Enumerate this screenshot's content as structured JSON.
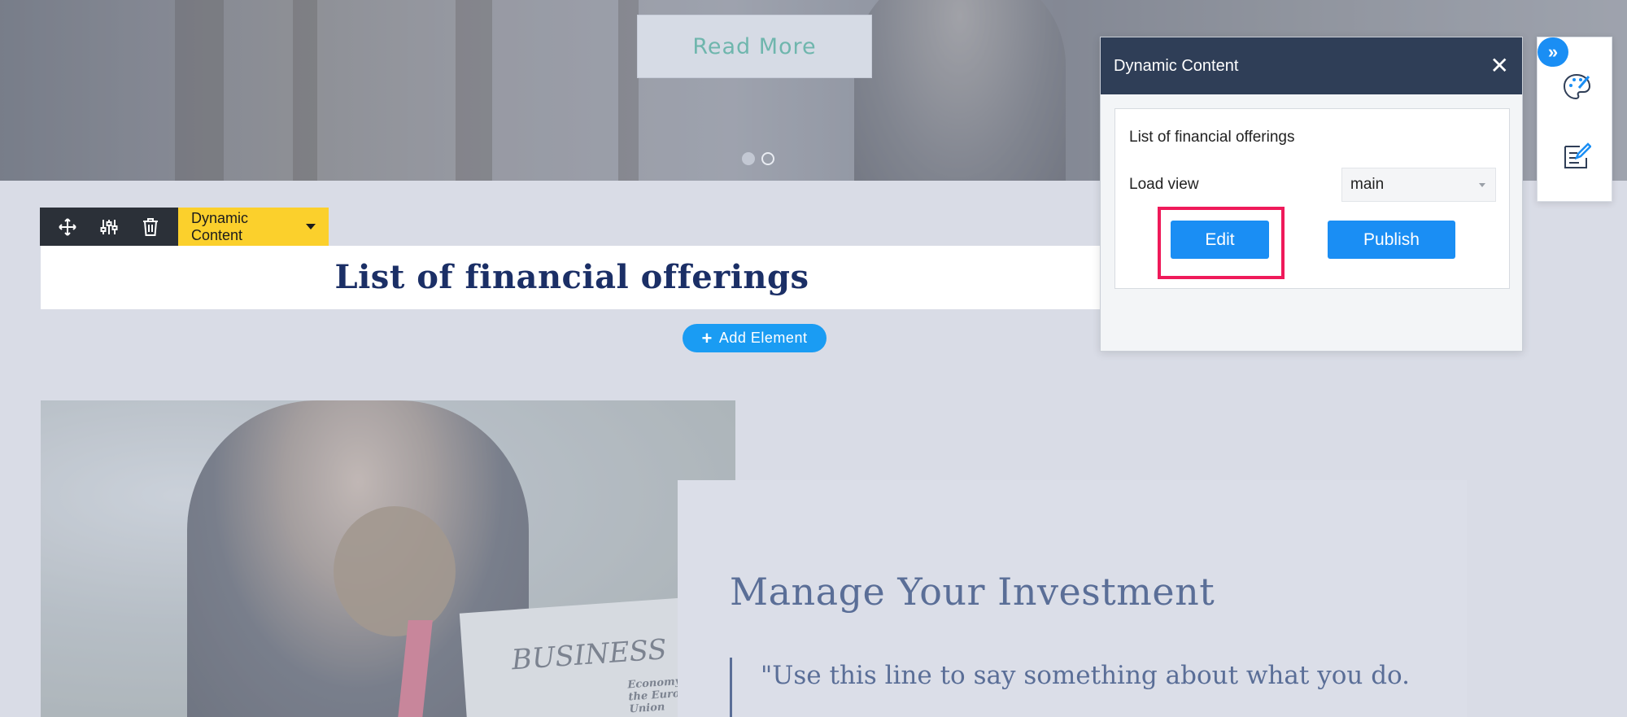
{
  "hero": {
    "read_more_label": "Read More",
    "slide_count": 2,
    "active_slide": 1
  },
  "element_toolbar": {
    "move_icon": "move-icon",
    "settings_icon": "sliders-icon",
    "delete_icon": "trash-icon",
    "type_label": "Dynamic Content"
  },
  "section_title": "List of financial offerings",
  "add_element_label": "Add Element",
  "add_element_icon": "+",
  "content": {
    "newspaper_headline": "BUSINESS",
    "newspaper_subhead": "Economy of the European Union",
    "heading": "Manage Your Investment",
    "quote": "\"Use this line to say something about what you do."
  },
  "panel": {
    "title": "Dynamic Content",
    "close_glyph": "✕",
    "content_name": "List of financial offerings",
    "load_view_label": "Load view",
    "load_view_value": "main",
    "edit_label": "Edit",
    "publish_label": "Publish"
  },
  "side_toolbar": {
    "toggle_glyph": "»",
    "icons": [
      "palette-icon",
      "edit-note-icon"
    ]
  },
  "colors": {
    "accent_blue": "#1a8ef4",
    "panel_header": "#2f3e57",
    "highlight": "#ef1a5a",
    "toolbar_yellow": "#fbd02c",
    "title_navy": "#1b2f66"
  }
}
